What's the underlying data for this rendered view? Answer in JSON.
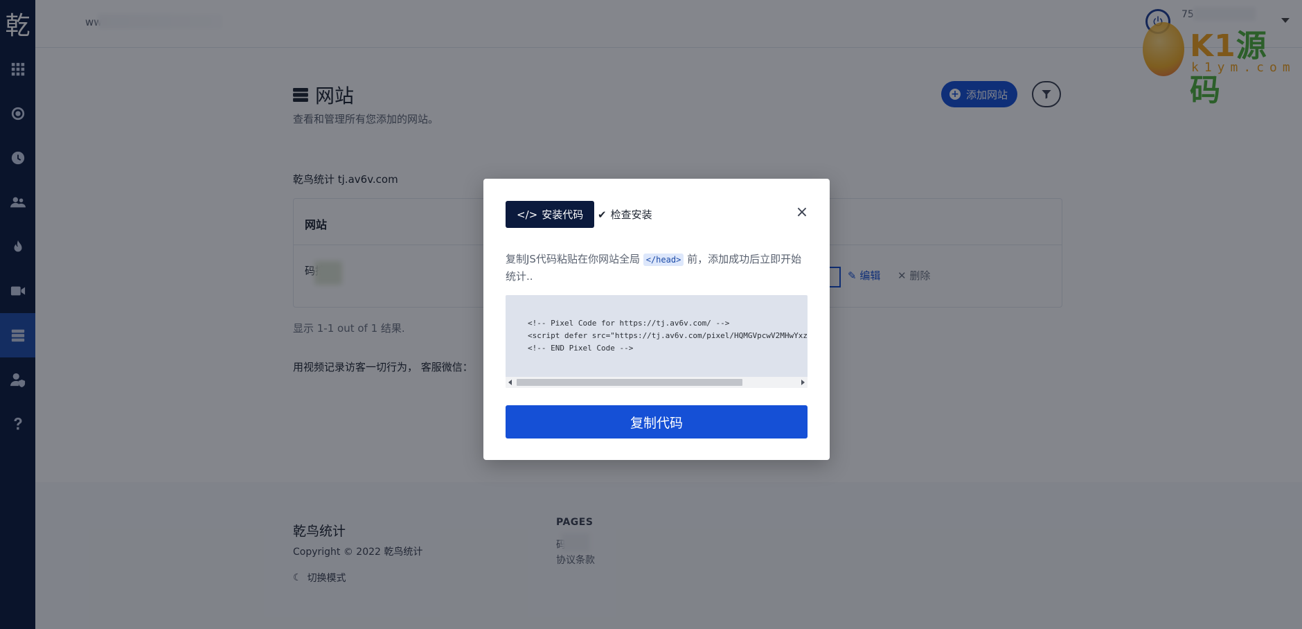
{
  "sidebar": {
    "logo": "乾",
    "items": [
      {
        "icon": "grid-icon"
      },
      {
        "icon": "target-icon"
      },
      {
        "icon": "clock-icon"
      },
      {
        "icon": "users-icon"
      },
      {
        "icon": "fire-icon"
      },
      {
        "icon": "video-icon"
      },
      {
        "icon": "server-icon",
        "active": true
      },
      {
        "icon": "user-shield-icon"
      },
      {
        "icon": "question-icon"
      }
    ]
  },
  "topbar": {
    "domain": "ww",
    "user": "75",
    "watermark": {
      "brand_k1": "K1",
      "brand_cn": "源码",
      "sub": "k1ym.com"
    }
  },
  "page": {
    "title": "网站",
    "subtitle": "查看和管理所有您添加的网站。",
    "add_button": "添加网站",
    "site_group": "乾鸟统计 tj.av6v.com",
    "table": {
      "header": "网站",
      "row_name": "码挖",
      "edit": "编辑",
      "delete": "删除"
    },
    "showing": "显示 1-1 out of 1 结果.",
    "notice": "用视频记录访客一切行为， 客服微信："
  },
  "footer": {
    "brand": "乾鸟统计",
    "copyright": "Copyright © 2022 乾鸟统计",
    "mode": "切换模式",
    "pages_heading": "PAGES",
    "link1": "码",
    "link2": "协议条款"
  },
  "modal": {
    "tab_install": "安装代码",
    "tab_check": "检查安装",
    "close": "×",
    "desc_before": "复制JS代码粘贴在你网站全局 ",
    "desc_code": "</head>",
    "desc_after": " 前，添加成功后立即开始统计..",
    "code_lines": "<!-- Pixel Code for https://tj.av6v.com/ -->\n<script defer src=\"https://tj.av6v.com/pixel/HQMGVpcwV2MHwYxz\n<!-- END Pixel Code -->",
    "copy_button": "复制代码"
  }
}
